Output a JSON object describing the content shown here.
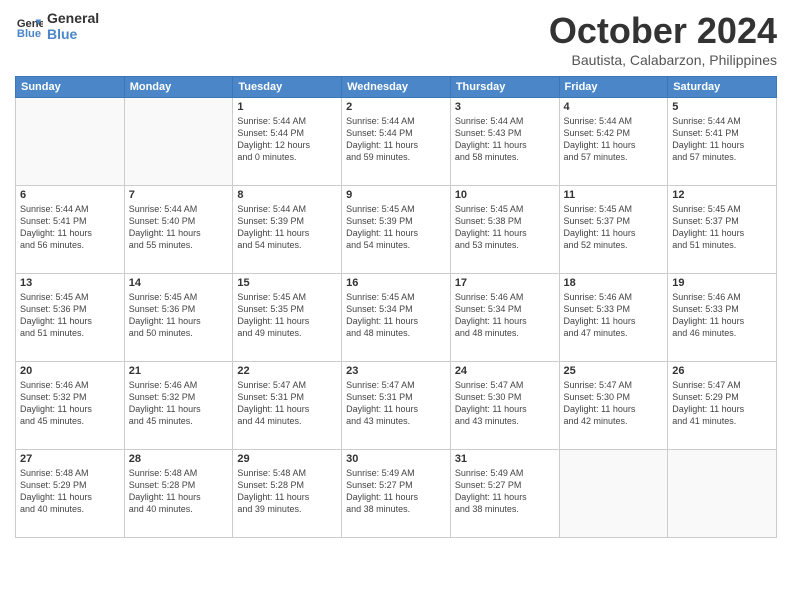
{
  "logo": {
    "line1": "General",
    "line2": "Blue"
  },
  "title": "October 2024",
  "location": "Bautista, Calabarzon, Philippines",
  "days_of_week": [
    "Sunday",
    "Monday",
    "Tuesday",
    "Wednesday",
    "Thursday",
    "Friday",
    "Saturday"
  ],
  "weeks": [
    [
      {
        "day": "",
        "info": ""
      },
      {
        "day": "",
        "info": ""
      },
      {
        "day": "1",
        "info": "Sunrise: 5:44 AM\nSunset: 5:44 PM\nDaylight: 12 hours\nand 0 minutes."
      },
      {
        "day": "2",
        "info": "Sunrise: 5:44 AM\nSunset: 5:44 PM\nDaylight: 11 hours\nand 59 minutes."
      },
      {
        "day": "3",
        "info": "Sunrise: 5:44 AM\nSunset: 5:43 PM\nDaylight: 11 hours\nand 58 minutes."
      },
      {
        "day": "4",
        "info": "Sunrise: 5:44 AM\nSunset: 5:42 PM\nDaylight: 11 hours\nand 57 minutes."
      },
      {
        "day": "5",
        "info": "Sunrise: 5:44 AM\nSunset: 5:41 PM\nDaylight: 11 hours\nand 57 minutes."
      }
    ],
    [
      {
        "day": "6",
        "info": "Sunrise: 5:44 AM\nSunset: 5:41 PM\nDaylight: 11 hours\nand 56 minutes."
      },
      {
        "day": "7",
        "info": "Sunrise: 5:44 AM\nSunset: 5:40 PM\nDaylight: 11 hours\nand 55 minutes."
      },
      {
        "day": "8",
        "info": "Sunrise: 5:44 AM\nSunset: 5:39 PM\nDaylight: 11 hours\nand 54 minutes."
      },
      {
        "day": "9",
        "info": "Sunrise: 5:45 AM\nSunset: 5:39 PM\nDaylight: 11 hours\nand 54 minutes."
      },
      {
        "day": "10",
        "info": "Sunrise: 5:45 AM\nSunset: 5:38 PM\nDaylight: 11 hours\nand 53 minutes."
      },
      {
        "day": "11",
        "info": "Sunrise: 5:45 AM\nSunset: 5:37 PM\nDaylight: 11 hours\nand 52 minutes."
      },
      {
        "day": "12",
        "info": "Sunrise: 5:45 AM\nSunset: 5:37 PM\nDaylight: 11 hours\nand 51 minutes."
      }
    ],
    [
      {
        "day": "13",
        "info": "Sunrise: 5:45 AM\nSunset: 5:36 PM\nDaylight: 11 hours\nand 51 minutes."
      },
      {
        "day": "14",
        "info": "Sunrise: 5:45 AM\nSunset: 5:36 PM\nDaylight: 11 hours\nand 50 minutes."
      },
      {
        "day": "15",
        "info": "Sunrise: 5:45 AM\nSunset: 5:35 PM\nDaylight: 11 hours\nand 49 minutes."
      },
      {
        "day": "16",
        "info": "Sunrise: 5:45 AM\nSunset: 5:34 PM\nDaylight: 11 hours\nand 48 minutes."
      },
      {
        "day": "17",
        "info": "Sunrise: 5:46 AM\nSunset: 5:34 PM\nDaylight: 11 hours\nand 48 minutes."
      },
      {
        "day": "18",
        "info": "Sunrise: 5:46 AM\nSunset: 5:33 PM\nDaylight: 11 hours\nand 47 minutes."
      },
      {
        "day": "19",
        "info": "Sunrise: 5:46 AM\nSunset: 5:33 PM\nDaylight: 11 hours\nand 46 minutes."
      }
    ],
    [
      {
        "day": "20",
        "info": "Sunrise: 5:46 AM\nSunset: 5:32 PM\nDaylight: 11 hours\nand 45 minutes."
      },
      {
        "day": "21",
        "info": "Sunrise: 5:46 AM\nSunset: 5:32 PM\nDaylight: 11 hours\nand 45 minutes."
      },
      {
        "day": "22",
        "info": "Sunrise: 5:47 AM\nSunset: 5:31 PM\nDaylight: 11 hours\nand 44 minutes."
      },
      {
        "day": "23",
        "info": "Sunrise: 5:47 AM\nSunset: 5:31 PM\nDaylight: 11 hours\nand 43 minutes."
      },
      {
        "day": "24",
        "info": "Sunrise: 5:47 AM\nSunset: 5:30 PM\nDaylight: 11 hours\nand 43 minutes."
      },
      {
        "day": "25",
        "info": "Sunrise: 5:47 AM\nSunset: 5:30 PM\nDaylight: 11 hours\nand 42 minutes."
      },
      {
        "day": "26",
        "info": "Sunrise: 5:47 AM\nSunset: 5:29 PM\nDaylight: 11 hours\nand 41 minutes."
      }
    ],
    [
      {
        "day": "27",
        "info": "Sunrise: 5:48 AM\nSunset: 5:29 PM\nDaylight: 11 hours\nand 40 minutes."
      },
      {
        "day": "28",
        "info": "Sunrise: 5:48 AM\nSunset: 5:28 PM\nDaylight: 11 hours\nand 40 minutes."
      },
      {
        "day": "29",
        "info": "Sunrise: 5:48 AM\nSunset: 5:28 PM\nDaylight: 11 hours\nand 39 minutes."
      },
      {
        "day": "30",
        "info": "Sunrise: 5:49 AM\nSunset: 5:27 PM\nDaylight: 11 hours\nand 38 minutes."
      },
      {
        "day": "31",
        "info": "Sunrise: 5:49 AM\nSunset: 5:27 PM\nDaylight: 11 hours\nand 38 minutes."
      },
      {
        "day": "",
        "info": ""
      },
      {
        "day": "",
        "info": ""
      }
    ]
  ]
}
